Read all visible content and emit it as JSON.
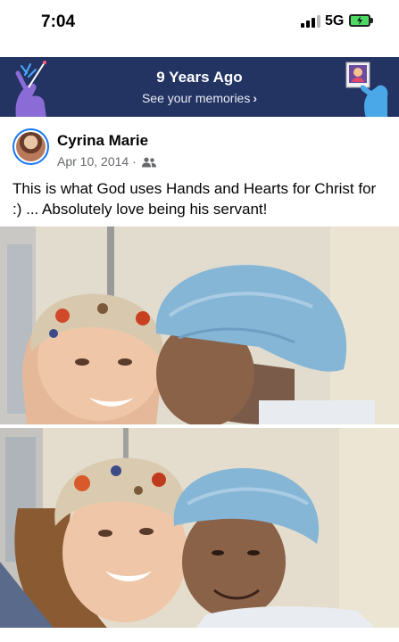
{
  "status_bar": {
    "time": "7:04",
    "network": "5G"
  },
  "memories": {
    "title": "9 Years Ago",
    "link_label": "See your memories",
    "chevron": "›",
    "background": "#233462"
  },
  "post": {
    "author": "Cyrina Marie",
    "date": "Apr 10, 2014",
    "separator": "·",
    "audience_icon": "friends-icon",
    "text": "This is what God uses Hands and Hearts for Christ for :) ... Absolutely love being his servant!"
  },
  "photos": [
    {
      "name": "photo-kiss"
    },
    {
      "name": "photo-smile"
    }
  ],
  "colors": {
    "accent": "#1877f2",
    "banner": "#233462",
    "text": "#050505",
    "meta": "#65676b"
  }
}
